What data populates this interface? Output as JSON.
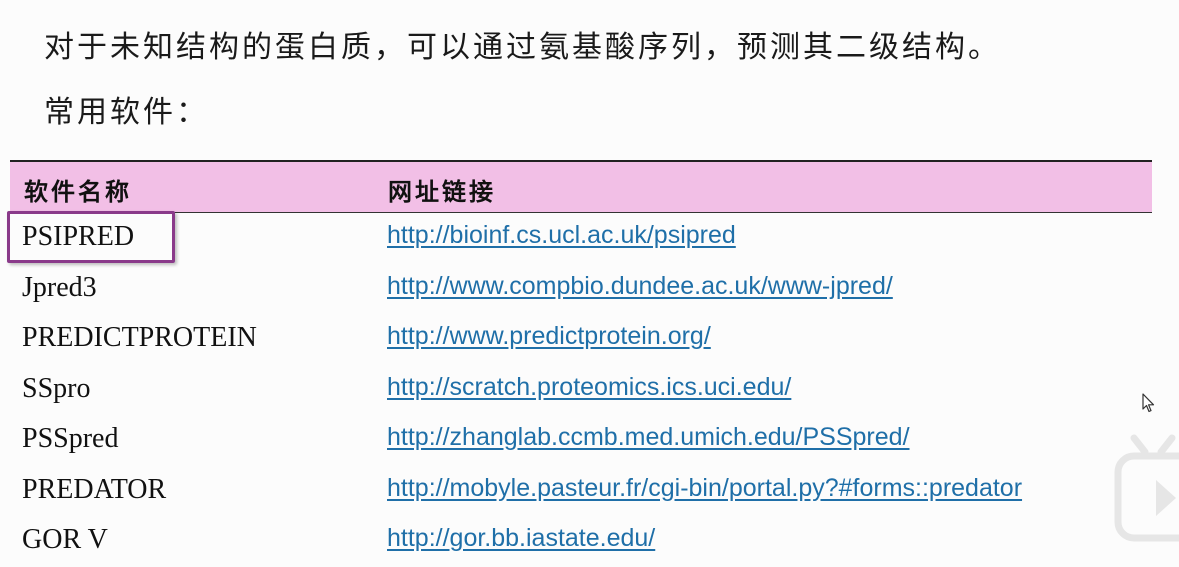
{
  "intro": {
    "line1": "对于未知结构的蛋白质，可以通过氨基酸序列，预测其二级结构。",
    "line2": "常用软件："
  },
  "table": {
    "headers": {
      "name": "软件名称",
      "url": "网址链接"
    },
    "rows": [
      {
        "name": "PSIPRED",
        "url": "http://bioinf.cs.ucl.ac.uk/psipred"
      },
      {
        "name": "Jpred3",
        "url": "http://www.compbio.dundee.ac.uk/www-jpred/"
      },
      {
        "name": "PREDICTPROTEIN",
        "url": "http://www.predictprotein.org/"
      },
      {
        "name": "SSpro",
        "url": "http://scratch.proteomics.ics.uci.edu/"
      },
      {
        "name": "PSSpred",
        "url": "http://zhanglab.ccmb.med.umich.edu/PSSpred/"
      },
      {
        "name": "PREDATOR",
        "url": "http://mobyle.pasteur.fr/cgi-bin/portal.py?#forms::predator"
      },
      {
        "name": "GOR V",
        "url": "http://gor.bb.iastate.edu/"
      }
    ]
  },
  "colors": {
    "header_bg": "#f2bfe6",
    "link": "#1f6fa8",
    "highlight": "#8a3a8a"
  },
  "icons": {
    "cursor": "mouse-pointer-icon",
    "logo": "tv-logo-icon"
  }
}
